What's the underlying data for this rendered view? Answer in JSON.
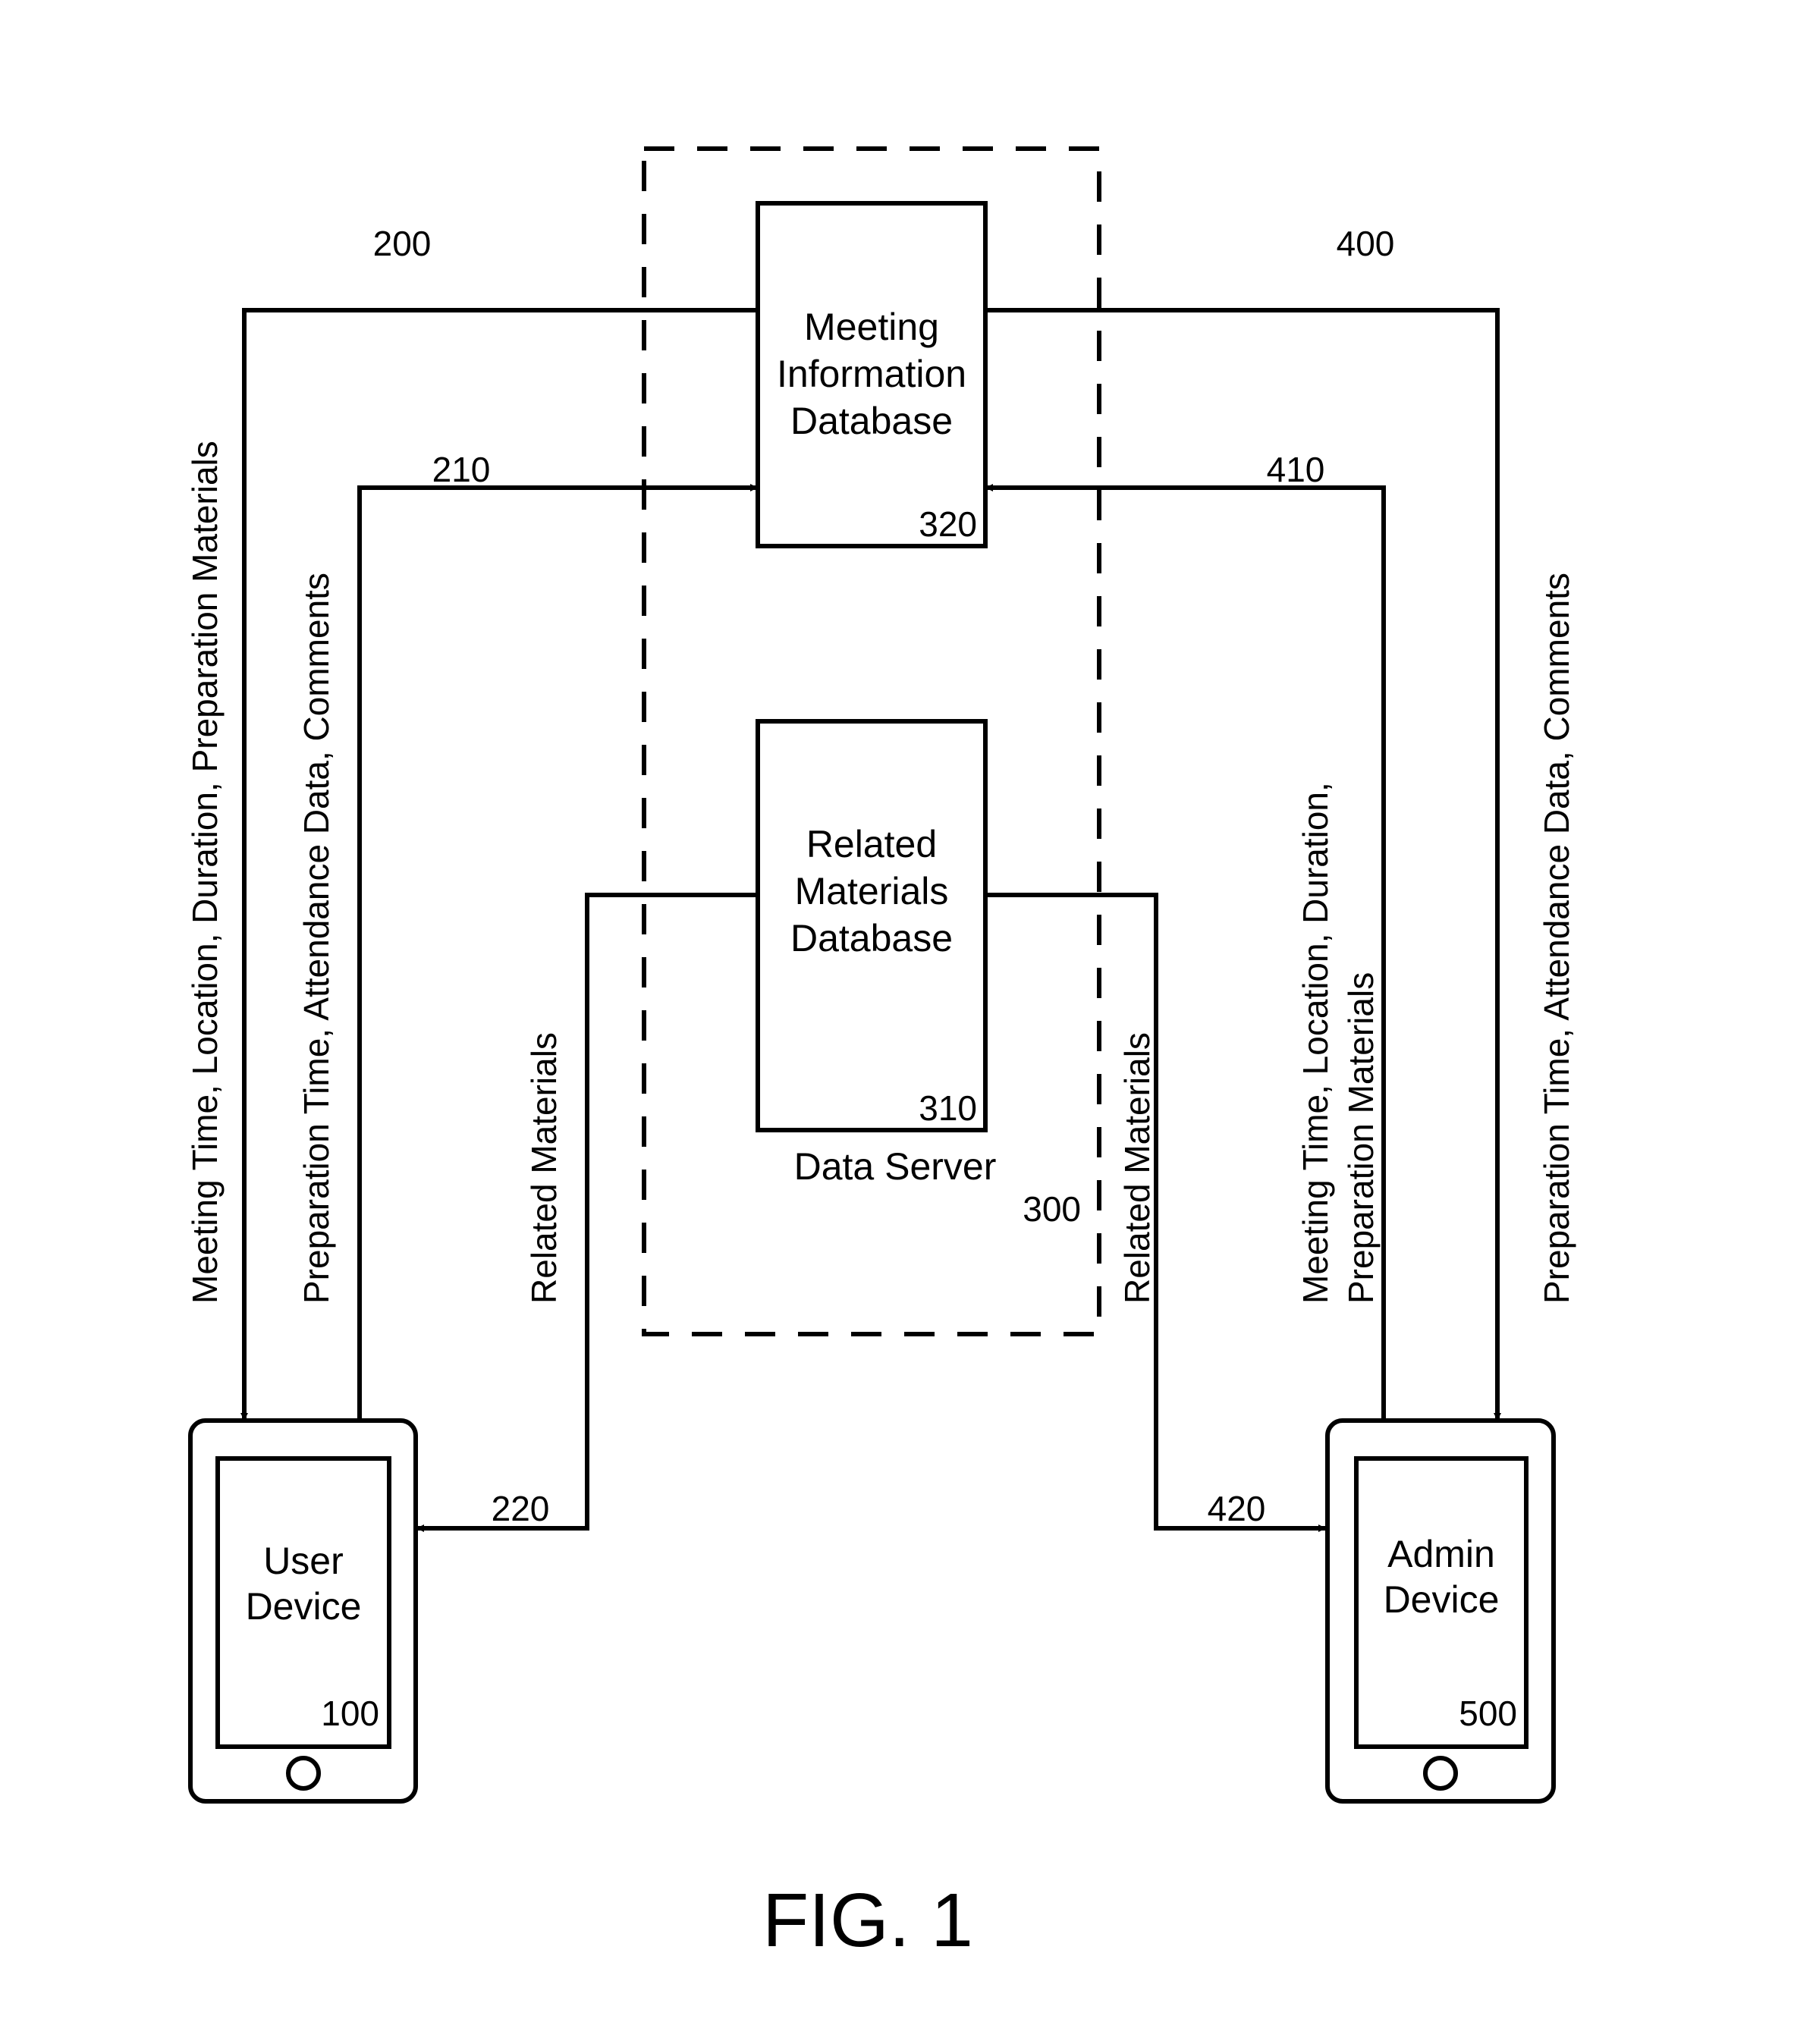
{
  "figure": {
    "caption": "FIG. 1",
    "data_server": {
      "label": "Data Server",
      "ref": "300"
    },
    "meeting_db": {
      "lines": [
        "Meeting",
        "Information",
        "Database"
      ],
      "ref": "320"
    },
    "materials_db": {
      "lines": [
        "Related",
        "Materials",
        "Database"
      ],
      "ref": "310"
    },
    "user_device": {
      "lines": [
        "User",
        "Device"
      ],
      "ref": "100"
    },
    "admin_device": {
      "lines": [
        "Admin",
        "Device"
      ],
      "ref": "500"
    },
    "flows": {
      "f200": {
        "ref": "200",
        "label": "Meeting Time, Location, Duration, Preparation Materials"
      },
      "f210": {
        "ref": "210",
        "label": "Preparation Time, Attendance Data, Comments"
      },
      "f220": {
        "ref": "220",
        "label": "Related Materials"
      },
      "f400": {
        "ref": "400",
        "label": "Preparation Time, Attendance Data, Comments"
      },
      "f410": {
        "ref": "410",
        "label_line1": "Meeting Time, Location, Duration,",
        "label_line2": "Preparation Materials"
      },
      "f420": {
        "ref": "420",
        "label": "Related Materials"
      }
    }
  }
}
